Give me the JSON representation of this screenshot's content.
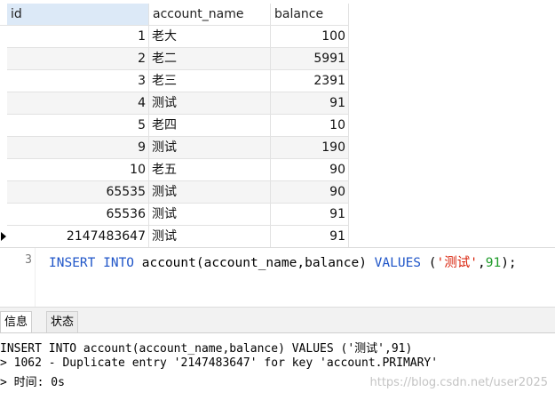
{
  "grid": {
    "columns": [
      "id",
      "account_name",
      "balance"
    ],
    "rows": [
      {
        "id": "1",
        "account_name": "老大",
        "balance": "100"
      },
      {
        "id": "2",
        "account_name": "老二",
        "balance": "5991"
      },
      {
        "id": "3",
        "account_name": "老三",
        "balance": "2391"
      },
      {
        "id": "4",
        "account_name": "测试",
        "balance": "91"
      },
      {
        "id": "5",
        "account_name": "老四",
        "balance": "10"
      },
      {
        "id": "9",
        "account_name": "测试",
        "balance": "190"
      },
      {
        "id": "10",
        "account_name": "老五",
        "balance": "90"
      },
      {
        "id": "65535",
        "account_name": "测试",
        "balance": "90"
      },
      {
        "id": "65536",
        "account_name": "测试",
        "balance": "91"
      },
      {
        "id": "2147483647",
        "account_name": "测试",
        "balance": "91"
      }
    ]
  },
  "editor": {
    "line_number": "3",
    "tokens": [
      {
        "text": "INSERT INTO",
        "kind": "kw"
      },
      {
        "text": " account(account_name,balance) ",
        "kind": "plain"
      },
      {
        "text": "VALUES",
        "kind": "kw"
      },
      {
        "text": " (",
        "kind": "plain"
      },
      {
        "text": "'测试'",
        "kind": "str"
      },
      {
        "text": ",",
        "kind": "plain"
      },
      {
        "text": "91",
        "kind": "num"
      },
      {
        "text": ");",
        "kind": "plain"
      }
    ]
  },
  "panel": {
    "tabs": [
      "信息",
      "状态"
    ],
    "messages": [
      "INSERT INTO account(account_name,balance) VALUES ('测试',91)",
      "> 1062 - Duplicate entry '2147483647' for key 'account.PRIMARY'",
      "> 时间: 0s"
    ],
    "watermark": "https://blog.csdn.net/user2025"
  },
  "colors": {
    "keyword": "#1f55c8",
    "string": "#d81e06",
    "number": "#1f9b2a",
    "header_selected": "#dce9f7"
  }
}
